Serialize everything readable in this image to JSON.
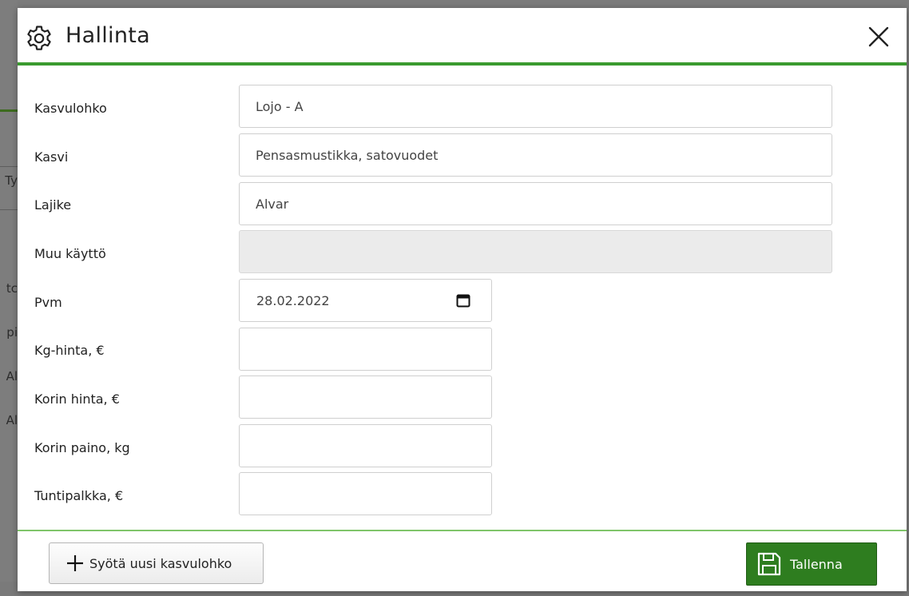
{
  "dialog": {
    "title": "Hallinta",
    "icon": "gear-icon",
    "close_icon": "close-icon"
  },
  "fields": [
    {
      "label": "Kasvulohko",
      "value": "Lojo - A",
      "disabled": false
    },
    {
      "label": "Kasvi",
      "value": "Pensasmustikka, satovuodet",
      "disabled": false
    },
    {
      "label": "Lajike",
      "value": "Alvar",
      "disabled": false
    },
    {
      "label": "Muu käyttö",
      "value": "",
      "disabled": true
    },
    {
      "label": "Pvm",
      "value": "28.02.2022",
      "type": "date"
    },
    {
      "label": "Kg-hinta, €",
      "value": ""
    },
    {
      "label": "Korin hinta, €",
      "value": ""
    },
    {
      "label": "Korin paino, kg",
      "value": ""
    },
    {
      "label": "Tuntipalkka, €",
      "value": ""
    }
  ],
  "footer": {
    "new_button_label": "Syötä uusi kasvulohko",
    "save_button_label": "Tallenna"
  },
  "background": {
    "letters": [
      "Ty",
      "tc",
      "pi",
      "Al",
      "Al"
    ]
  },
  "colors": {
    "accent_green": "#3a9b2f",
    "save_button": "#2e7d1f",
    "footer_line": "#7fc56a"
  }
}
